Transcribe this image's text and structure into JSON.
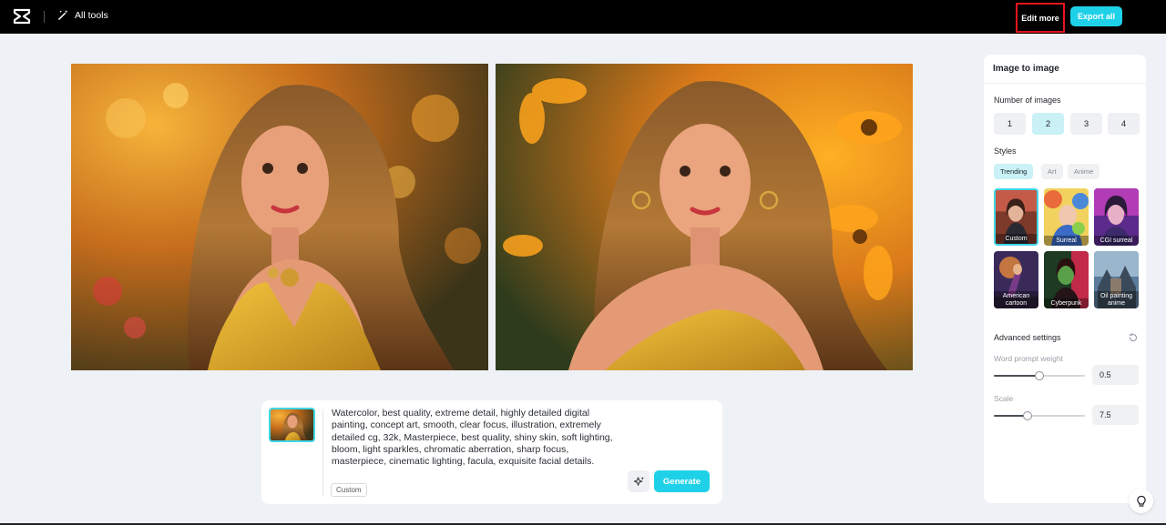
{
  "header": {
    "all_tools_label": "All tools",
    "edit_more_label": "Edit more",
    "export_all_label": "Export all"
  },
  "prompt": {
    "text": "Watercolor, best quality, extreme detail, highly detailed digital painting, concept art, smooth, clear focus, illustration, extremely detailed cg, 32k, Masterpiece, best quality, shiny skin, soft lighting, bloom, light sparkles, chromatic aberration, sharp focus, masterpiece, cinematic lighting, facula, exquisite facial details.",
    "style_tag": "Custom",
    "generate_label": "Generate"
  },
  "panel": {
    "title": "Image to image",
    "number_label": "Number of images",
    "counts": [
      "1",
      "2",
      "3",
      "4"
    ],
    "selected_count": "2",
    "styles_label": "Styles",
    "style_tabs": [
      "Trending",
      "Art",
      "Anime"
    ],
    "styles": [
      "Custom",
      "Surreal",
      "CGI surreal",
      "American cartoon",
      "Cyberpunk",
      "Oil painting anime"
    ],
    "advanced_label": "Advanced settings",
    "word_prompt_weight_label": "Word prompt weight",
    "word_prompt_weight_value": "0.5",
    "scale_label": "Scale",
    "scale_value": "7.5"
  },
  "colors": {
    "accent": "#1fd1e8",
    "highlight_box": "#e8141b"
  }
}
